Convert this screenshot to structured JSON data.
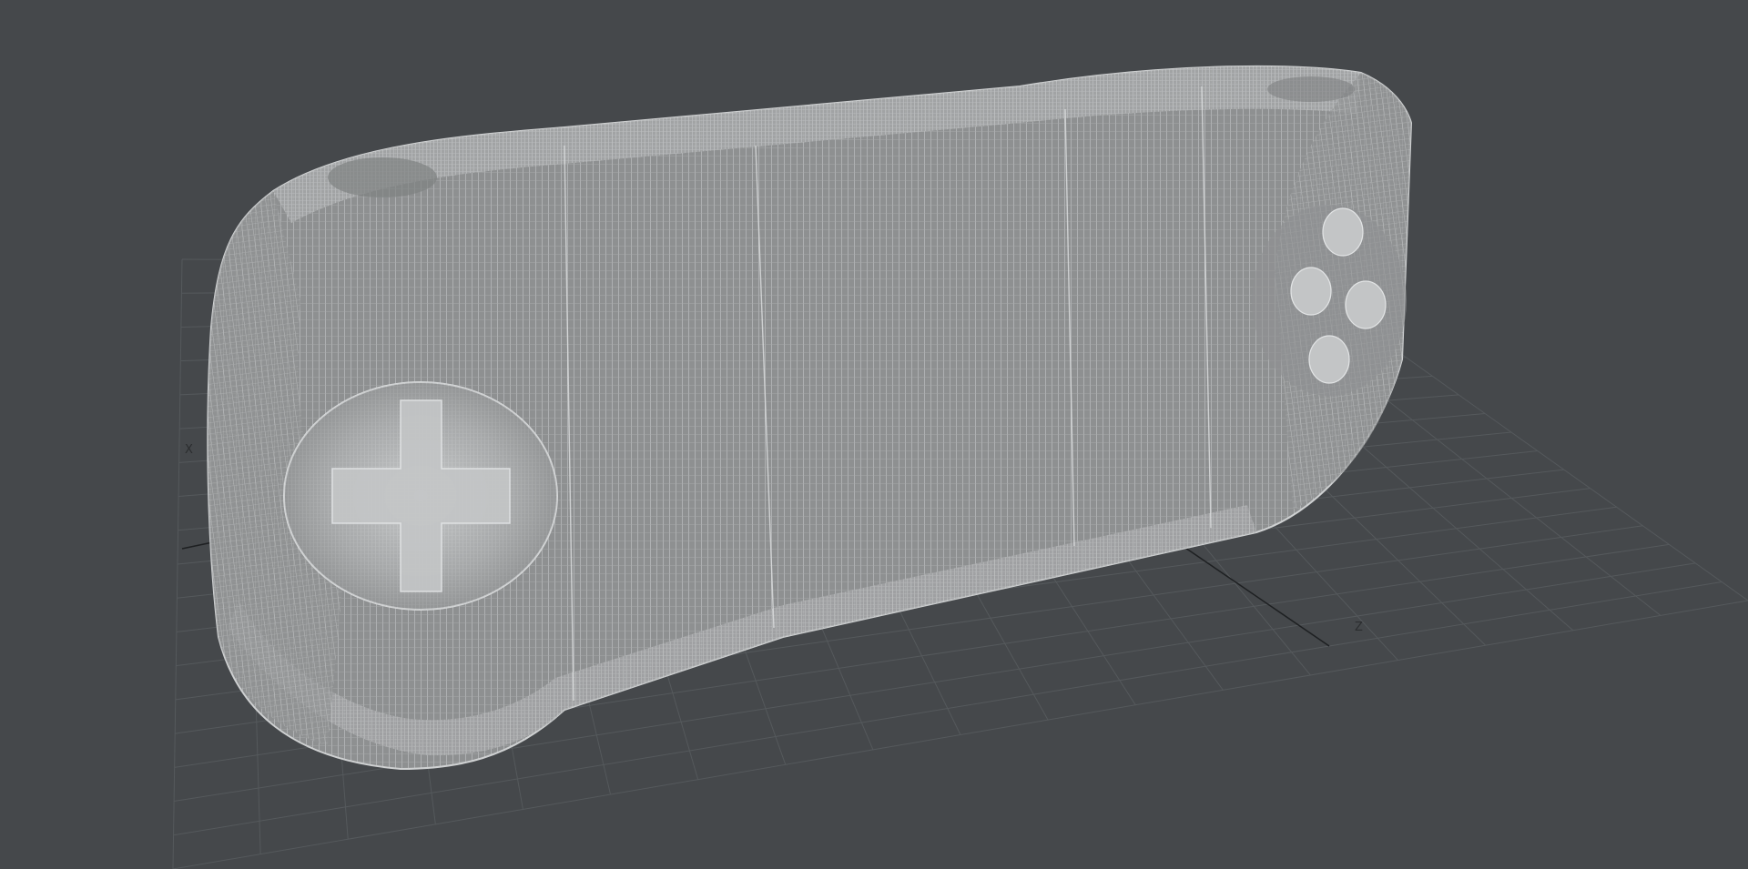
{
  "viewport": {
    "background": "#45484b",
    "grid_color": "#55595c",
    "axis_line_color": "#1e2022",
    "wire_color": "#b4b6b7",
    "wire_fill": "#8a8c8d",
    "shading_mode": "wireframe"
  },
  "axes": {
    "x_label": "X",
    "z_label": "Z"
  },
  "mesh": {
    "object": "handheld-console",
    "icons": [
      "dpad-icon",
      "face-buttons-icon"
    ]
  }
}
